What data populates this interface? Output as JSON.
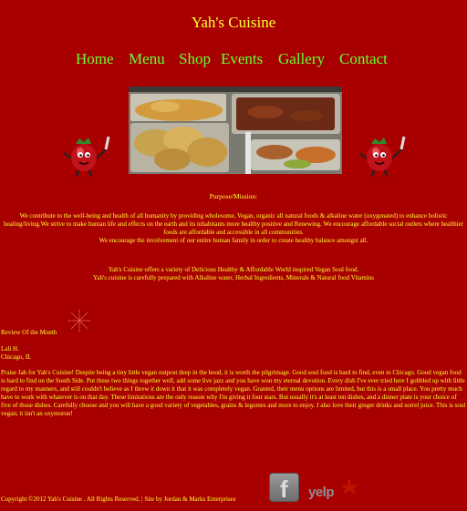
{
  "header": {
    "site_title": "Yah's Cuisine"
  },
  "nav": {
    "items": [
      {
        "label": "Home"
      },
      {
        "label": "Menu"
      },
      {
        "label": "Shop"
      },
      {
        "label": "Events"
      },
      {
        "label": "Gallery"
      },
      {
        "label": "Contact"
      }
    ]
  },
  "hero": {
    "image_icon": "food-buffet-photo",
    "mascot_icon": "tomato-chef-mascot"
  },
  "mission": {
    "heading": "Purpose/Mission:",
    "line1": "We contribute to the well-being and health of all humanity by providing wholesome, Vegan, organic all natural foods & alkaline water (oxygenated) to enhance holistic healing/living.We strive to make human life and effects on the earth and its inhabitants more healthy positive and Renewing. We encourage affordable social outlets where healthier foods are affordable and accessible in all communities.",
    "line2": "We encourage the involvement of our entire human family in order to create healthy balance amongst all."
  },
  "offer": {
    "line1": "Yah's Cuisine offers a variety of Delicious Healthy & Affordable World inspired Vegan Soul food.",
    "line2": "Yah's cuisine is carefully prepared with Alkaline water, Herbal Ingredients, Minerals & Natural food Vitamins"
  },
  "review": {
    "label": "Review Of the Month",
    "reviewer_name": "Lali H.",
    "reviewer_city": "Chicago, IL",
    "text": "Praise Jah for Yah's Cuisine! Despite being a tiny little vegan outpost deep in the hood, it is worth the pilgrimage. Good soul food is hard to find, even in Chicago. Good vegan food is hard to find on the South Side. Put these two things together well, add some live jazz and you have won my eternal devotion. Every dish I've ever tried here I gobbled up with little regard to my manners, and still couldn't believe as I threw it down it that it was completely vegan. Granted, their menu options are limited, but this is a small place.  You pretty much have to work with whatever is on that day. These limitations are the only reason why I'm giving it four stars. But usually it's at least ten dishes, and a dinner plate is your choice of five of those dishes. Carefully choose and you will have a good variety of vegetables, grains & legumes and more to enjoy. I also love their ginger drinks and sorrel juice. This is soul vegan; it isn't an oxymoron!"
  },
  "footer": {
    "copyright": "Copyright ©2012 Yah's Cuisine . All Rights Reserved. | Site by Jordan & Marks Enterprises",
    "facebook_letter": "f",
    "yelp_word": "yelp"
  },
  "colors": {
    "background": "#a80000",
    "text": "#ffff33",
    "nav": "#66ff33"
  }
}
